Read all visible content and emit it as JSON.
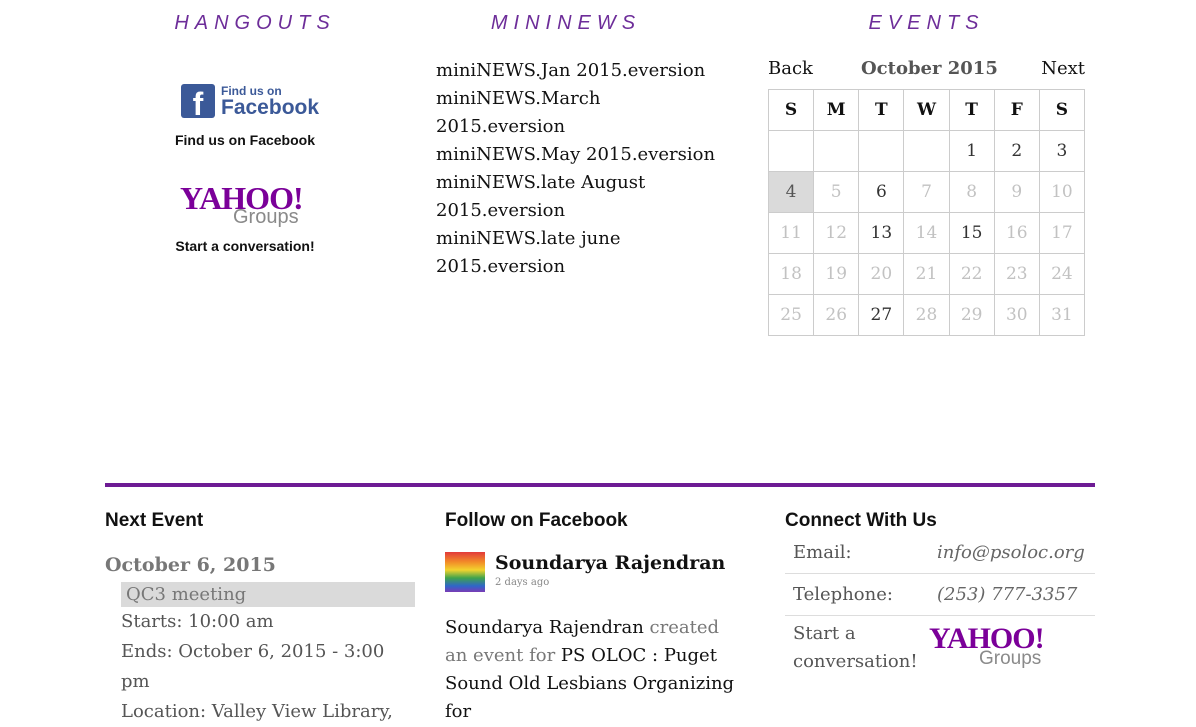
{
  "hangouts": {
    "heading": "HANGOUTS",
    "facebook_logo": {
      "small": "Find us on",
      "big": "Facebook",
      "letter": "f"
    },
    "facebook_caption": "Find us on Facebook",
    "yahoo_logo": {
      "wordmark": "YAHOO!",
      "sub": "Groups"
    },
    "yahoo_caption": "Start a conversation!"
  },
  "mininews": {
    "heading": "MININEWS",
    "items": [
      "miniNEWS.Jan 2015.eversion",
      "miniNEWS.March 2015.eversion",
      "miniNEWS.May 2015.eversion",
      "miniNEWS.late August 2015.eversion",
      "miniNEWS.late june 2015.eversion"
    ]
  },
  "events": {
    "heading": "EVENTS",
    "back_label": "Back",
    "next_label": "Next",
    "month_label": "October  2015",
    "weekdays": [
      "S",
      "M",
      "T",
      "W",
      "T",
      "F",
      "S"
    ],
    "weeks": [
      [
        {
          "d": ""
        },
        {
          "d": ""
        },
        {
          "d": ""
        },
        {
          "d": ""
        },
        {
          "d": "1",
          "s": "active"
        },
        {
          "d": "2",
          "s": "active"
        },
        {
          "d": "3",
          "s": "active"
        }
      ],
      [
        {
          "d": "4",
          "s": "today"
        },
        {
          "d": "5",
          "s": "muted"
        },
        {
          "d": "6",
          "s": "active"
        },
        {
          "d": "7",
          "s": "muted"
        },
        {
          "d": "8",
          "s": "muted"
        },
        {
          "d": "9",
          "s": "muted"
        },
        {
          "d": "10",
          "s": "muted"
        }
      ],
      [
        {
          "d": "11",
          "s": "muted"
        },
        {
          "d": "12",
          "s": "muted"
        },
        {
          "d": "13",
          "s": "active"
        },
        {
          "d": "14",
          "s": "muted"
        },
        {
          "d": "15",
          "s": "active"
        },
        {
          "d": "16",
          "s": "muted"
        },
        {
          "d": "17",
          "s": "muted"
        }
      ],
      [
        {
          "d": "18",
          "s": "muted"
        },
        {
          "d": "19",
          "s": "muted"
        },
        {
          "d": "20",
          "s": "muted"
        },
        {
          "d": "21",
          "s": "muted"
        },
        {
          "d": "22",
          "s": "muted"
        },
        {
          "d": "23",
          "s": "muted"
        },
        {
          "d": "24",
          "s": "muted"
        }
      ],
      [
        {
          "d": "25",
          "s": "muted"
        },
        {
          "d": "26",
          "s": "muted"
        },
        {
          "d": "27",
          "s": "active"
        },
        {
          "d": "28",
          "s": "muted"
        },
        {
          "d": "29",
          "s": "muted"
        },
        {
          "d": "30",
          "s": "muted"
        },
        {
          "d": "31",
          "s": "muted"
        }
      ]
    ]
  },
  "footer": {
    "next_event": {
      "title": "Next Event",
      "date": "October 6, 2015",
      "event_title": "QC3 meeting",
      "starts": "Starts: 10:00 am",
      "ends": "Ends: October 6, 2015 - 3:00 pm",
      "location": "Location: Valley View Library,"
    },
    "follow": {
      "title": "Follow on Facebook",
      "poster_name": "Soundarya Rajendran",
      "post_time": "2 days ago",
      "body_name": "Soundarya Rajendran",
      "body_middle": " created an event for ",
      "body_group": "PS OLOC : Puget Sound Old Lesbians Organizing for"
    },
    "connect": {
      "title": "Connect With Us",
      "email_label": "Email:",
      "email_value": "info@psoloc.org",
      "phone_label": "Telephone:",
      "phone_value": "(253) 777-3357",
      "conversation_label": "Start a conversation!",
      "yahoo_logo": {
        "wordmark": "YAHOO!",
        "sub": "Groups"
      }
    }
  },
  "colors": {
    "accent": "#6d1b94",
    "heading": "#6d2d99",
    "facebook": "#3b5998",
    "yahoo": "#7b0099"
  }
}
